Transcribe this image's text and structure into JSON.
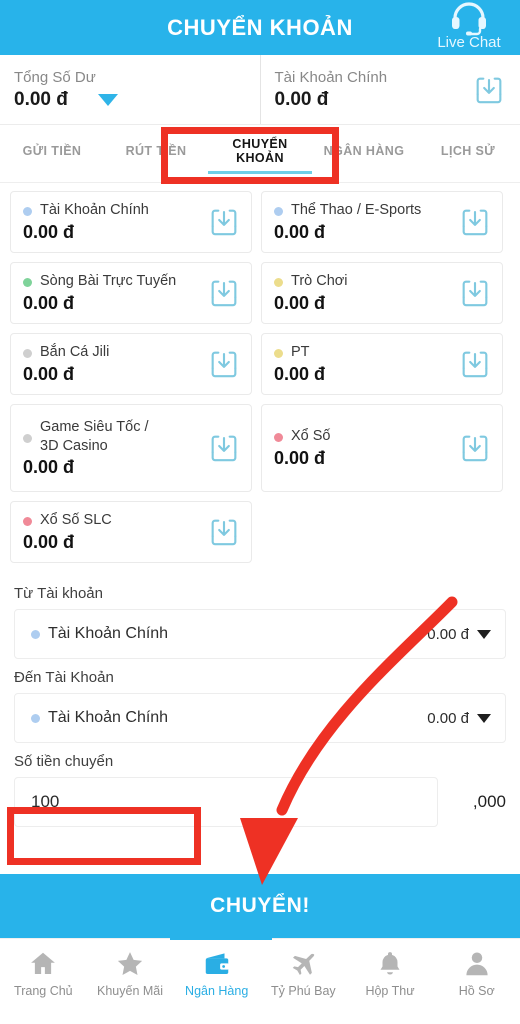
{
  "header": {
    "title": "CHUYỂN KHOẢN",
    "live_chat_label": "Live Chat",
    "live_chat_icon": "headset-icon"
  },
  "balance": {
    "total": {
      "label": "Tổng Số Dư",
      "value": "0.00 đ",
      "caret_icon": "caret-down-icon"
    },
    "main": {
      "label": "Tài Khoản Chính",
      "value": "0.00 đ",
      "action_icon": "download-icon"
    }
  },
  "tabs": [
    {
      "label": "GỬI TIỀN",
      "active": false
    },
    {
      "label": "RÚT TIỀN",
      "active": false
    },
    {
      "label": "CHUYỂN KHOẢN",
      "active": true
    },
    {
      "label": "NGÂN HÀNG",
      "active": false
    },
    {
      "label": "LỊCH SỬ",
      "active": false
    }
  ],
  "accounts": [
    {
      "name": "Tài Khoản Chính",
      "amount": "0.00 đ",
      "dot_color": "#aecdf0",
      "action_icon": "download-icon"
    },
    {
      "name": "Thể Thao / E-Sports",
      "amount": "0.00 đ",
      "dot_color": "#aecdf0",
      "action_icon": "download-icon"
    },
    {
      "name": "Sòng Bài Trực Tuyến",
      "amount": "0.00 đ",
      "dot_color": "#7fd39a",
      "action_icon": "download-icon"
    },
    {
      "name": "Trò Chơi",
      "amount": "0.00 đ",
      "dot_color": "#ecdd8c",
      "action_icon": "download-icon"
    },
    {
      "name": "Bắn Cá Jili",
      "amount": "0.00 đ",
      "dot_color": "#cfcfcf",
      "action_icon": "download-icon"
    },
    {
      "name": "PT",
      "amount": "0.00 đ",
      "dot_color": "#ecdd8c",
      "action_icon": "download-icon"
    },
    {
      "name": "Game Siêu Tốc /\n3D Casino",
      "amount": "0.00 đ",
      "dot_color": "#cfcfcf",
      "action_icon": "download-icon"
    },
    {
      "name": "Xổ Số",
      "amount": "0.00 đ",
      "dot_color": "#f08a98",
      "action_icon": "download-icon"
    },
    {
      "name": "Xổ Số SLC",
      "amount": "0.00 đ",
      "dot_color": "#f08a98",
      "action_icon": "download-icon"
    }
  ],
  "form": {
    "from_label": "Từ Tài khoản",
    "from_account": {
      "name": "Tài Khoản Chính",
      "value": "0.00 đ",
      "dot_color": "#aecdf0",
      "caret_icon": "caret-down-icon"
    },
    "to_label": "Đến Tài Khoản",
    "to_account": {
      "name": "Tài Khoản Chính",
      "value": "0.00 đ",
      "dot_color": "#aecdf0",
      "caret_icon": "caret-down-icon"
    },
    "amount_label": "Số tiền chuyển",
    "amount_value": "100",
    "amount_placeholder": "0",
    "amount_suffix": ",000"
  },
  "submit": {
    "label": "CHUYỂN!"
  },
  "bottom_nav": [
    {
      "label": "Trang Chủ",
      "icon": "home-icon",
      "active": false
    },
    {
      "label": "Khuyến Mãi",
      "icon": "star-icon",
      "active": false
    },
    {
      "label": "Ngân Hàng",
      "icon": "wallet-icon",
      "active": true
    },
    {
      "label": "Tỷ Phú Bay",
      "icon": "airplane-icon",
      "active": false
    },
    {
      "label": "Hộp Thư",
      "icon": "bell-icon",
      "active": false
    },
    {
      "label": "Hồ Sơ",
      "icon": "person-icon",
      "active": false
    }
  ],
  "annotations": {
    "color": "#ee3124",
    "tab_highlight_target": "CHUYỂN KHOẢN",
    "input_highlight_target": "100",
    "arrow_target": "CHUYỂN!"
  },
  "colors": {
    "brand_blue": "#28b3ea",
    "accent_underline": "#6fcfe6",
    "annotation_red": "#ee3124"
  }
}
